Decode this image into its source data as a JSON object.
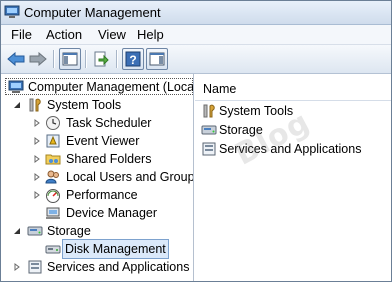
{
  "window": {
    "title": "Computer Management"
  },
  "menubar": {
    "items": [
      "File",
      "Action",
      "View",
      "Help"
    ]
  },
  "toolbar": {
    "buttons": [
      "back-icon",
      "forward-icon",
      "show-hide-console-tree-icon",
      "export-list-icon",
      "help-icon",
      "show-hide-action-pane-icon"
    ]
  },
  "tree": {
    "root": "Computer Management (Local",
    "system_tools": "System Tools",
    "task_scheduler": "Task Scheduler",
    "event_viewer": "Event Viewer",
    "shared_folders": "Shared Folders",
    "local_users": "Local Users and Groups",
    "performance": "Performance",
    "device_manager": "Device Manager",
    "storage": "Storage",
    "disk_management": "Disk Management",
    "services": "Services and Applications"
  },
  "list": {
    "column_name": "Name",
    "items": [
      "System Tools",
      "Storage",
      "Services and Applications"
    ]
  },
  "watermark": "Blog"
}
